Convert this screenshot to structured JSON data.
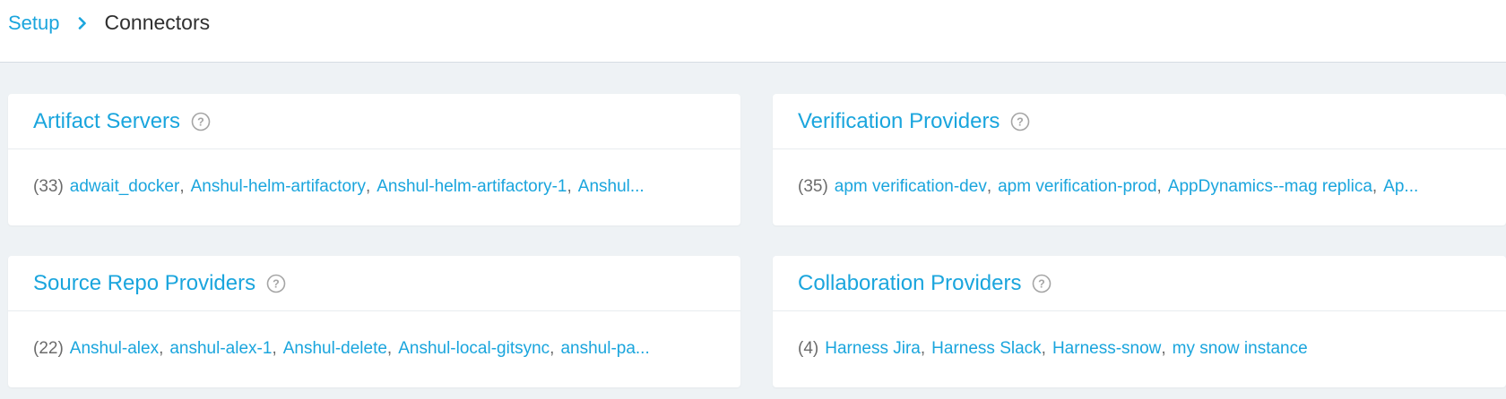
{
  "breadcrumb": {
    "parent": "Setup",
    "current": "Connectors"
  },
  "colors": {
    "accent": "#1aa5dd",
    "background": "#eef2f5",
    "help_icon": "#a5a5a5"
  },
  "cards": [
    {
      "title": "Artifact Servers",
      "count": "(33)",
      "items": [
        "adwait_docker",
        "Anshul-helm-artifactory",
        "Anshul-helm-artifactory-1",
        "Anshul..."
      ]
    },
    {
      "title": "Verification Providers",
      "count": "(35)",
      "items": [
        "apm verification-dev",
        "apm verification-prod",
        "AppDynamics--mag replica",
        "Ap..."
      ]
    },
    {
      "title": "Source Repo Providers",
      "count": "(22)",
      "items": [
        "Anshul-alex",
        "anshul-alex-1",
        "Anshul-delete",
        "Anshul-local-gitsync",
        "anshul-pa..."
      ]
    },
    {
      "title": "Collaboration Providers",
      "count": "(4)",
      "items": [
        "Harness Jira",
        "Harness Slack",
        "Harness-snow",
        "my snow instance"
      ]
    }
  ]
}
